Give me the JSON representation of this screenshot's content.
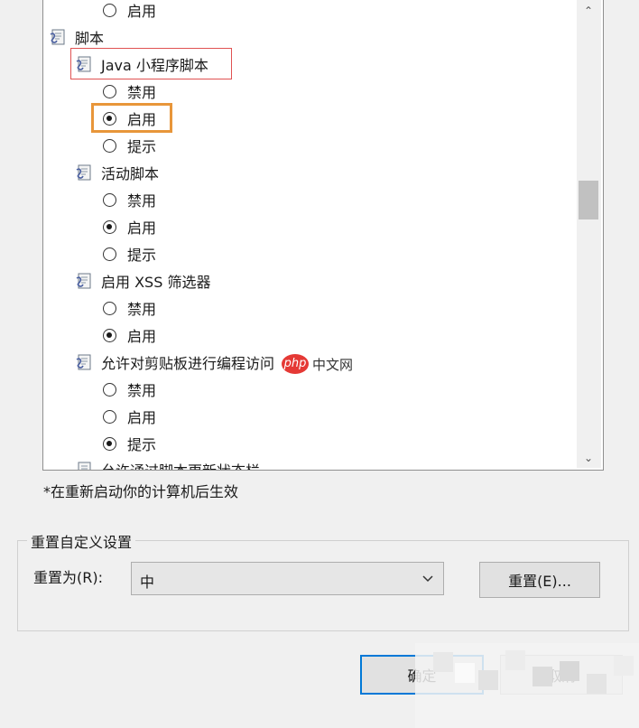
{
  "tree": {
    "items": [
      {
        "kind": "radio",
        "label": "启用",
        "checked": false
      },
      {
        "kind": "header",
        "label": "脚本",
        "icon": "script-icon"
      },
      {
        "kind": "header",
        "label": "Java 小程序脚本",
        "icon": "script-icon"
      },
      {
        "kind": "radio",
        "label": "禁用",
        "checked": false
      },
      {
        "kind": "radio",
        "label": "启用",
        "checked": true
      },
      {
        "kind": "radio",
        "label": "提示",
        "checked": false
      },
      {
        "kind": "header",
        "label": "活动脚本",
        "icon": "script-icon"
      },
      {
        "kind": "radio",
        "label": "禁用",
        "checked": false
      },
      {
        "kind": "radio",
        "label": "启用",
        "checked": true
      },
      {
        "kind": "radio",
        "label": "提示",
        "checked": false
      },
      {
        "kind": "header",
        "label": "启用 XSS 筛选器",
        "icon": "script-icon"
      },
      {
        "kind": "radio",
        "label": "禁用",
        "checked": false
      },
      {
        "kind": "radio",
        "label": "启用",
        "checked": true
      },
      {
        "kind": "header",
        "label": "允许对剪贴板进行编程访问",
        "icon": "script-icon"
      },
      {
        "kind": "radio",
        "label": "禁用",
        "checked": false
      },
      {
        "kind": "radio",
        "label": "启用",
        "checked": false
      },
      {
        "kind": "radio",
        "label": "提示",
        "checked": true
      },
      {
        "kind": "header",
        "label": "允许通过脚本更新状态栏",
        "icon": "script-icon"
      }
    ]
  },
  "scrollbar": {
    "up": "⌃",
    "down": "⌄"
  },
  "note": "*在重新启动你的计算机后生效",
  "reset_group": {
    "title": "重置自定义设置",
    "reset_to_label": "重置为(R):",
    "selected_level": "中",
    "reset_button": "重置(E)..."
  },
  "footer": {
    "ok_button": "确定",
    "cancel_button": "取消"
  },
  "watermark": {
    "php": "php",
    "site": "中文网"
  },
  "colors": {
    "red_highlight": "#e05252",
    "orange_highlight": "#e8963a",
    "focus_blue": "#0078d7"
  }
}
